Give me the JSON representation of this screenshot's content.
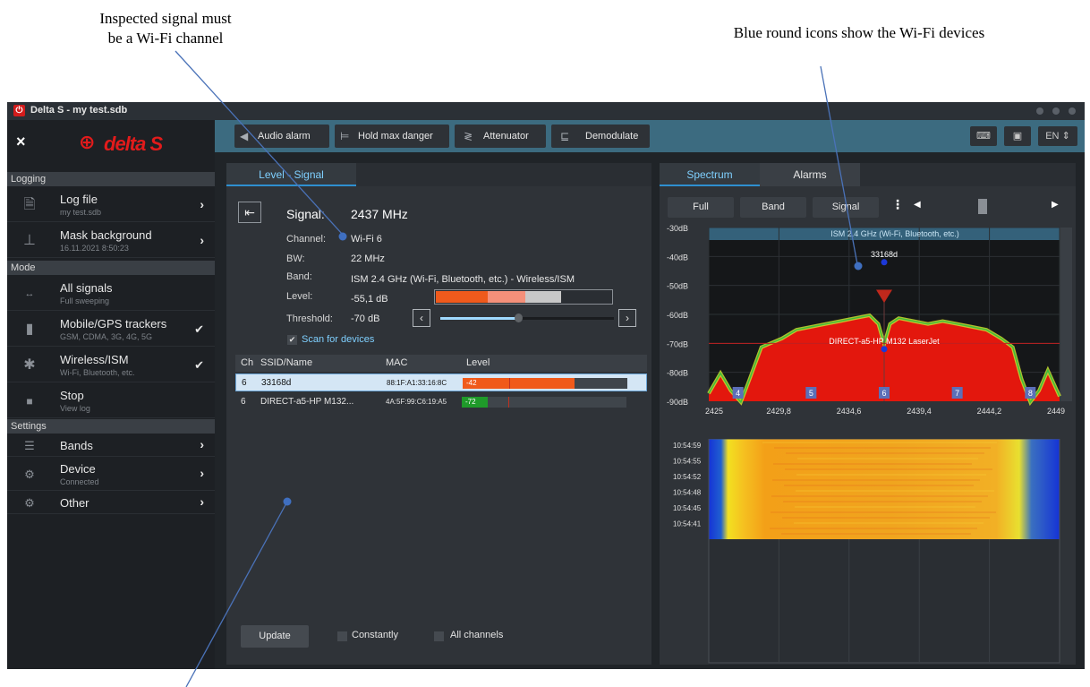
{
  "annotations": {
    "top_left_line1": "Inspected signal must",
    "top_left_line2": "be a Wi-Fi channel",
    "top_right": "Blue round icons show the Wi-Fi devices"
  },
  "window": {
    "app_icon": "⏻",
    "title": "Delta S - my test.sdb"
  },
  "sidebar": {
    "close_icon": "×",
    "logo_text": "delta S",
    "sections": [
      "Logging",
      "Mode",
      "Settings"
    ],
    "logging": [
      {
        "label": "Log file",
        "sub": "my test.sdb",
        "icon": "file-icon"
      },
      {
        "label": "Mask background",
        "sub": "16.11.2021 8:50:23",
        "icon": "mask-icon"
      }
    ],
    "mode": [
      {
        "label": "All signals",
        "sub": "Full sweeping",
        "icon": "all-signals-icon",
        "checked": false
      },
      {
        "label": "Mobile/GPS trackers",
        "sub": "GSM, CDMA, 3G, 4G, 5G",
        "icon": "mobile-bars-icon",
        "checked": true
      },
      {
        "label": "Wireless/ISM",
        "sub": "Wi-Fi, Bluetooth, etc.",
        "icon": "wireless-icon",
        "checked": true
      },
      {
        "label": "Stop",
        "sub": "View log",
        "icon": "stop-icon",
        "checked": false
      }
    ],
    "settings": [
      {
        "label": "Bands",
        "sub": "",
        "icon": "bands-icon"
      },
      {
        "label": "Device",
        "sub": "Connected",
        "icon": "device-icon"
      },
      {
        "label": "Other",
        "sub": "",
        "icon": "other-icon"
      }
    ]
  },
  "toolbar": {
    "audio_alarm": "Audio alarm",
    "hold_max_danger": "Hold max danger",
    "attenuator": "Attenuator",
    "demodulate": "Demodulate",
    "language": "EN"
  },
  "left_panel": {
    "tab": "Level - Signal",
    "signal_label": "Signal:",
    "signal_value": "2437 MHz",
    "channel_label": "Channel:",
    "channel_value": "Wi-Fi 6",
    "bw_label": "BW:",
    "bw_value": "22 MHz",
    "band_label": "Band:",
    "band_value": "ISM 2.4 GHz (Wi-Fi, Bluetooth, etc.) - Wireless/ISM",
    "level_label": "Level:",
    "level_value": "-55,1 dB",
    "threshold_label": "Threshold:",
    "threshold_value": "-70 dB",
    "threshold_slider_fraction": 0.45,
    "scan_label": "Scan for devices",
    "table_headers": [
      "Ch",
      "SSID/Name",
      "MAC",
      "Level"
    ],
    "devices": [
      {
        "ch": "6",
        "ssid": "33168d",
        "mac": "88:1F:A1:33:16:8C",
        "level": "-42",
        "fill": 0.68,
        "color": "#f05a1a",
        "selected": true
      },
      {
        "ch": "6",
        "ssid": "DIRECT-a5-HP M132...",
        "mac": "4A:5F:99:C6:19:A5",
        "level": "-72",
        "fill": 0.16,
        "color": "#1f9a2a",
        "selected": false
      }
    ],
    "update_button": "Update",
    "constantly_label": "Constantly",
    "all_channels_label": "All channels"
  },
  "right_panel": {
    "tab_spectrum": "Spectrum",
    "tab_alarms": "Alarms",
    "btn_full": "Full",
    "btn_band": "Band",
    "btn_signal": "Signal",
    "band_title": "ISM 2.4 GHz (Wi-Fi, Bluetooth, etc.)",
    "device1_label": "33168d",
    "device2_label": "DIRECT-a5-HP M132 LaserJet",
    "y_ticks": [
      "-30dB",
      "-40dB",
      "-50dB",
      "-60dB",
      "-70dB",
      "-80dB",
      "-90dB"
    ],
    "x_ticks": [
      "2425",
      "2429,8",
      "2434,6",
      "2439,4",
      "2444,2",
      "2449"
    ],
    "channel_markers": [
      "4",
      "5",
      "6",
      "7",
      "8"
    ],
    "wf_times": [
      "10:54:59",
      "10:54:55",
      "10:54:52",
      "10:54:48",
      "10:54:45",
      "10:54:41"
    ]
  },
  "chart_data": {
    "type": "area",
    "title": "ISM 2.4 GHz (Wi-Fi, Bluetooth, etc.)",
    "xlabel": "",
    "ylabel": "",
    "xlim": [
      2425,
      2449
    ],
    "ylim": [
      -90,
      -30
    ],
    "x_ticks": [
      2425,
      2429.8,
      2434.6,
      2439.4,
      2444.2,
      2449
    ],
    "y_ticks": [
      -30,
      -40,
      -50,
      -60,
      -70,
      -80,
      -90
    ],
    "threshold_db": -70,
    "markers": [
      {
        "label": "33168d",
        "x": 2437,
        "y": -42
      },
      {
        "label": "DIRECT-a5-HP M132 LaserJet",
        "x": 2437,
        "y": -72
      }
    ],
    "channels": [
      {
        "label": "4",
        "x": 2427
      },
      {
        "label": "5",
        "x": 2432
      },
      {
        "label": "6",
        "x": 2437
      },
      {
        "label": "7",
        "x": 2442
      },
      {
        "label": "8",
        "x": 2447
      }
    ],
    "envelope": {
      "x": [
        2425,
        2425.8,
        2426.5,
        2427.2,
        2427.8,
        2428.6,
        2430,
        2431,
        2432,
        2433,
        2434,
        2435,
        2436,
        2436.6,
        2437,
        2437.4,
        2438,
        2439,
        2440,
        2441,
        2442,
        2443,
        2444,
        2445,
        2445.8,
        2446.4,
        2447,
        2447.6,
        2448.2,
        2449
      ],
      "y": [
        -87,
        -80,
        -86,
        -90,
        -82,
        -71,
        -68,
        -65,
        -64,
        -63,
        -62,
        -61,
        -60,
        -63,
        -70,
        -63,
        -61,
        -62,
        -63,
        -62,
        -63,
        -64,
        -65,
        -68,
        -71,
        -82,
        -90,
        -86,
        -79,
        -88
      ]
    }
  },
  "colors": {
    "accent_blue": "#2e8fd0",
    "toolbar": "#3c6b80",
    "brand_red": "#e21b1b",
    "threshold_line": "#c02020"
  }
}
